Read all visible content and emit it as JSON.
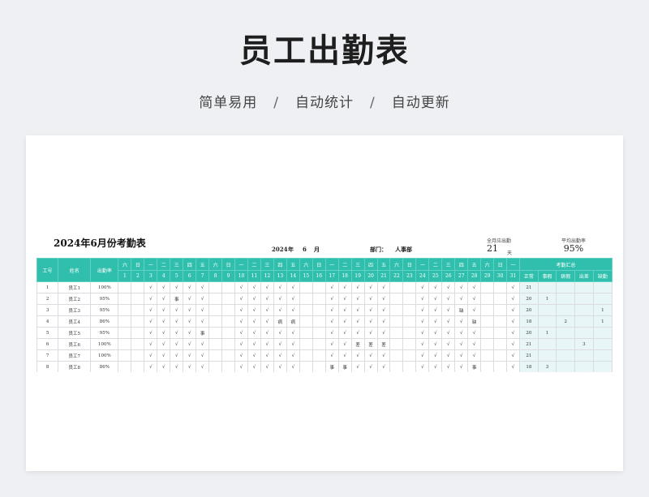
{
  "header": {
    "title": "员工出勤表",
    "features": [
      "简单易用",
      "自动统计",
      "自动更新"
    ],
    "separator": "/"
  },
  "sheet": {
    "title": "2024年6月份考勤表",
    "year": "2024",
    "year_label": "年",
    "month": "6",
    "month_label": "月",
    "dept_label": "部门：",
    "dept_value": "人事部",
    "full_days_label": "全月应出勤",
    "full_days_value": "21",
    "full_days_unit": "天",
    "avg_rate_label": "平均出勤率",
    "avg_rate_value": "95%"
  },
  "table": {
    "col_id": "工号",
    "col_name": "姓名",
    "col_rate": "出勤率",
    "summary_header": "考勤汇总",
    "summary_cols": [
      "正常",
      "事假",
      "病假",
      "出差",
      "缺勤"
    ],
    "weekdays": [
      "六",
      "日",
      "一",
      "二",
      "三",
      "四",
      "五",
      "六",
      "日",
      "一",
      "二",
      "三",
      "四",
      "五",
      "六",
      "日",
      "一",
      "二",
      "三",
      "四",
      "五",
      "六",
      "日",
      "一",
      "二",
      "三",
      "四",
      "五",
      "六",
      "日",
      "一"
    ],
    "days": [
      "1",
      "2",
      "3",
      "4",
      "5",
      "6",
      "7",
      "8",
      "9",
      "10",
      "11",
      "12",
      "13",
      "14",
      "15",
      "16",
      "17",
      "18",
      "19",
      "20",
      "21",
      "22",
      "23",
      "24",
      "25",
      "26",
      "27",
      "28",
      "29",
      "30",
      "31"
    ],
    "rows": [
      {
        "id": "1",
        "name": "员工1",
        "rate": "100%",
        "days": [
          "",
          "",
          "√",
          "√",
          "√",
          "√",
          "√",
          "",
          "",
          "√",
          "√",
          "√",
          "√",
          "√",
          "",
          "",
          "√",
          "√",
          "√",
          "√",
          "√",
          "",
          "",
          "√",
          "√",
          "√",
          "√",
          "√",
          "",
          "",
          "√"
        ],
        "summary": [
          "21",
          "",
          "",
          "",
          ""
        ]
      },
      {
        "id": "2",
        "name": "员工2",
        "rate": "95%",
        "days": [
          "",
          "",
          "√",
          "√",
          "事",
          "√",
          "√",
          "",
          "",
          "√",
          "√",
          "√",
          "√",
          "√",
          "",
          "",
          "√",
          "√",
          "√",
          "√",
          "√",
          "",
          "",
          "√",
          "√",
          "√",
          "√",
          "√",
          "",
          "",
          "√"
        ],
        "summary": [
          "20",
          "1",
          "",
          "",
          ""
        ]
      },
      {
        "id": "3",
        "name": "员工3",
        "rate": "95%",
        "days": [
          "",
          "",
          "√",
          "√",
          "√",
          "√",
          "√",
          "",
          "",
          "√",
          "√",
          "√",
          "√",
          "√",
          "",
          "",
          "√",
          "√",
          "√",
          "√",
          "√",
          "",
          "",
          "√",
          "√",
          "√",
          "缺",
          "√",
          "",
          "",
          "√"
        ],
        "summary": [
          "20",
          "",
          "",
          "",
          "1"
        ]
      },
      {
        "id": "4",
        "name": "员工4",
        "rate": "86%",
        "days": [
          "",
          "",
          "√",
          "√",
          "√",
          "√",
          "√",
          "",
          "",
          "√",
          "√",
          "√",
          "病",
          "病",
          "",
          "",
          "√",
          "√",
          "√",
          "√",
          "√",
          "",
          "",
          "√",
          "√",
          "√",
          "√",
          "缺",
          "",
          "",
          "√"
        ],
        "summary": [
          "18",
          "",
          "2",
          "",
          "1"
        ]
      },
      {
        "id": "5",
        "name": "员工5",
        "rate": "95%",
        "days": [
          "",
          "",
          "√",
          "√",
          "√",
          "√",
          "事",
          "",
          "",
          "√",
          "√",
          "√",
          "√",
          "√",
          "",
          "",
          "√",
          "√",
          "√",
          "√",
          "√",
          "",
          "",
          "√",
          "√",
          "√",
          "√",
          "√",
          "",
          "",
          "√"
        ],
        "summary": [
          "20",
          "1",
          "",
          "",
          ""
        ]
      },
      {
        "id": "6",
        "name": "员工6",
        "rate": "100%",
        "days": [
          "",
          "",
          "√",
          "√",
          "√",
          "√",
          "√",
          "",
          "",
          "√",
          "√",
          "√",
          "√",
          "√",
          "",
          "",
          "√",
          "√",
          "差",
          "差",
          "差",
          "",
          "",
          "√",
          "√",
          "√",
          "√",
          "√",
          "",
          "",
          "√"
        ],
        "summary": [
          "21",
          "",
          "",
          "3",
          ""
        ]
      },
      {
        "id": "7",
        "name": "员工7",
        "rate": "100%",
        "days": [
          "",
          "",
          "√",
          "√",
          "√",
          "√",
          "√",
          "",
          "",
          "√",
          "√",
          "√",
          "√",
          "√",
          "",
          "",
          "√",
          "√",
          "√",
          "√",
          "√",
          "",
          "",
          "√",
          "√",
          "√",
          "√",
          "√",
          "",
          "",
          "√"
        ],
        "summary": [
          "21",
          "",
          "",
          "",
          ""
        ]
      },
      {
        "id": "8",
        "name": "员工8",
        "rate": "86%",
        "days": [
          "",
          "",
          "√",
          "√",
          "√",
          "√",
          "√",
          "",
          "",
          "√",
          "√",
          "√",
          "√",
          "√",
          "",
          "",
          "事",
          "事",
          "√",
          "√",
          "√",
          "",
          "",
          "√",
          "√",
          "√",
          "√",
          "事",
          "",
          "",
          "√"
        ],
        "summary": [
          "18",
          "3",
          "",
          "",
          ""
        ]
      }
    ]
  }
}
